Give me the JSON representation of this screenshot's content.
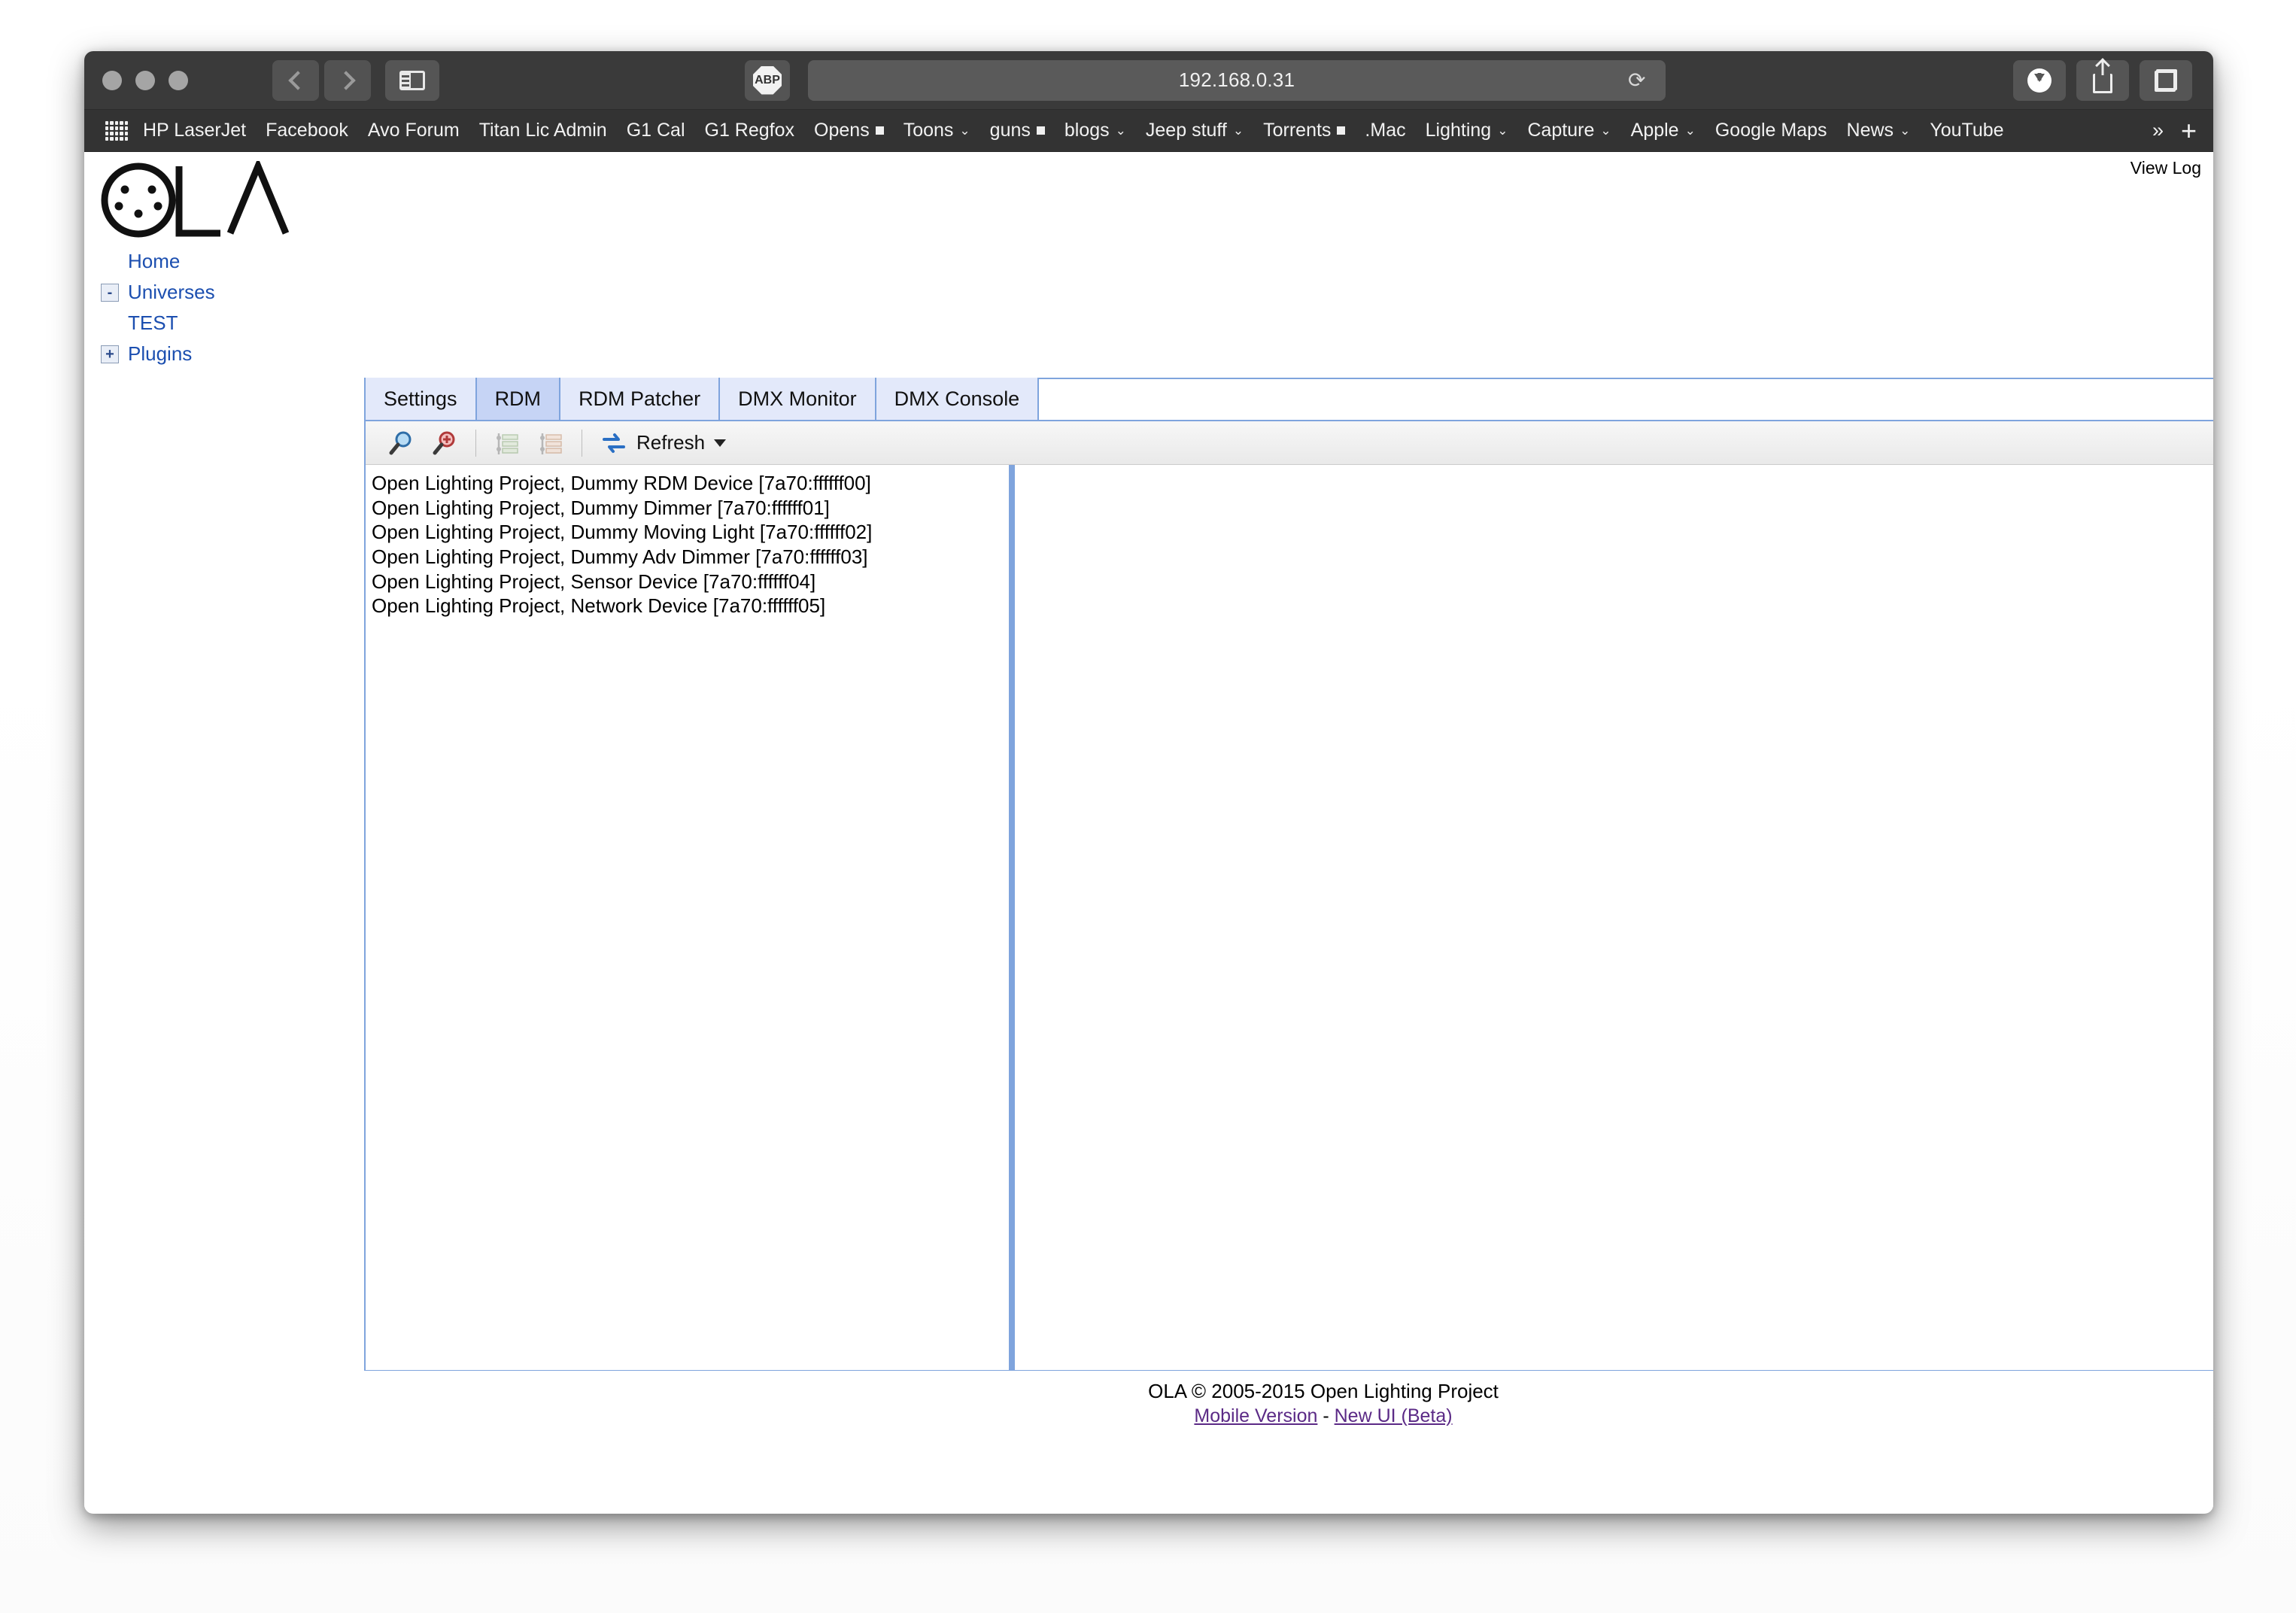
{
  "browser": {
    "url": "192.168.0.31",
    "abp_label": "ABP",
    "back_icon": "back-chevron-icon",
    "forward_icon": "forward-chevron-icon",
    "sidebar_icon": "sidebar-toggle-icon",
    "reload_icon": "reload-icon",
    "download_icon": "download-icon",
    "share_icon": "share-icon",
    "tabs_icon": "tab-overview-icon",
    "apps_grid_icon": "apps-grid-icon",
    "overflow_label": "»",
    "newtab_label": "+"
  },
  "bookmarks": [
    {
      "label": "HP LaserJet",
      "marker": ""
    },
    {
      "label": "Facebook",
      "marker": ""
    },
    {
      "label": "Avo Forum",
      "marker": ""
    },
    {
      "label": "Titan Lic Admin",
      "marker": ""
    },
    {
      "label": "G1 Cal",
      "marker": ""
    },
    {
      "label": "G1 Regfox",
      "marker": ""
    },
    {
      "label": "Opens",
      "marker": "square"
    },
    {
      "label": "Toons",
      "marker": "caret"
    },
    {
      "label": "guns",
      "marker": "square"
    },
    {
      "label": "blogs",
      "marker": "caret"
    },
    {
      "label": "Jeep stuff",
      "marker": "caret"
    },
    {
      "label": "Torrents",
      "marker": "square"
    },
    {
      "label": ".Mac",
      "marker": ""
    },
    {
      "label": "Lighting",
      "marker": "caret"
    },
    {
      "label": "Capture",
      "marker": "caret"
    },
    {
      "label": "Apple",
      "marker": "caret"
    },
    {
      "label": "Google Maps",
      "marker": ""
    },
    {
      "label": "News",
      "marker": "caret"
    },
    {
      "label": "YouTube",
      "marker": ""
    }
  ],
  "page": {
    "view_log": "View Log",
    "logo_text": "LA",
    "logo_icon": "ola-dmx-connector-logo"
  },
  "sidebar": {
    "items": [
      {
        "label": "Home",
        "toggle": "",
        "indent": true
      },
      {
        "label": "Universes",
        "toggle": "-",
        "indent": false
      },
      {
        "label": "TEST",
        "toggle": "",
        "indent": true
      },
      {
        "label": "Plugins",
        "toggle": "+",
        "indent": false
      }
    ]
  },
  "tabs": [
    {
      "label": "Settings",
      "active": false
    },
    {
      "label": "RDM",
      "active": true
    },
    {
      "label": "RDM Patcher",
      "active": false
    },
    {
      "label": "DMX Monitor",
      "active": false
    },
    {
      "label": "DMX Console",
      "active": false
    }
  ],
  "rdm_toolbar": {
    "discover_icon": "magnifier-icon",
    "incremental_discover_icon": "magnifier-plus-icon",
    "uid_list_icon": "list-add-icon",
    "uid_remove_icon": "list-remove-icon",
    "refresh_icon": "refresh-arrows-icon",
    "refresh_label": "Refresh",
    "refresh_caret_icon": "caret-down-icon"
  },
  "devices": [
    "Open Lighting Project, Dummy RDM Device [7a70:ffffff00]",
    "Open Lighting Project, Dummy Dimmer [7a70:ffffff01]",
    "Open Lighting Project, Dummy Moving Light [7a70:ffffff02]",
    "Open Lighting Project, Dummy Adv Dimmer [7a70:ffffff03]",
    "Open Lighting Project, Sensor Device [7a70:ffffff04]",
    "Open Lighting Project, Network Device [7a70:ffffff05]"
  ],
  "footer": {
    "copyright": "OLA © 2005-2015 Open Lighting Project",
    "mobile_link": "Mobile Version",
    "separator": " - ",
    "newui_link": "New UI (Beta)"
  },
  "colors": {
    "chrome_toolbar": "#3a3a3a",
    "bookmark_bar": "#333333",
    "panel_border": "#7fa4dd",
    "tab_inactive": "#e3e9fa",
    "tab_active": "#c6d4f5",
    "link": "#1c4fb0",
    "visited_link": "#5b2a86"
  }
}
